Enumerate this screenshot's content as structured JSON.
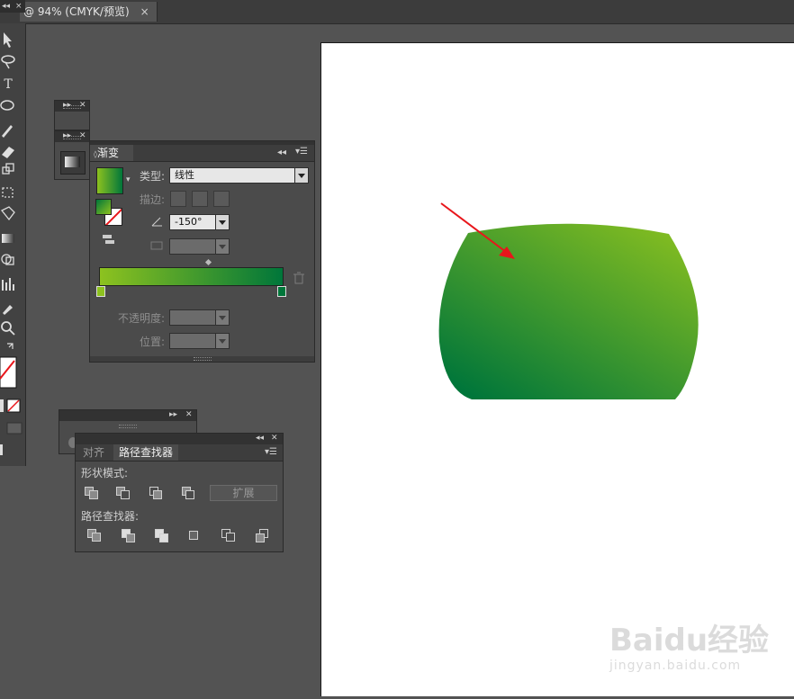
{
  "document": {
    "tab_title": "@ 94% (CMYK/预览)",
    "close_glyph": "×"
  },
  "toolbox": {
    "collapse_glyph": "◂◂",
    "close_glyph": "×",
    "tools": [
      "selection-tool",
      "lasso-tool",
      "type-tool",
      "ellipse-tool",
      "pencil-tool",
      "eraser-tool",
      "scale-tool",
      "free-transform-tool",
      "shape-builder-tool",
      "mesh-tool",
      "blend-tool",
      "graph-tool",
      "eyedropper-tool",
      "zoom-tool",
      "swap-colors-tool"
    ],
    "type_tool_glyph": "T"
  },
  "gradient_panel": {
    "title": "渐变",
    "type_label": "类型:",
    "type_value": "线性",
    "stroke_label": "描边:",
    "angle_value": "-150°",
    "opacity_label": "不透明度:",
    "position_label": "位置:",
    "gradient_colors": [
      "#8dc21f",
      "#00763a"
    ]
  },
  "pathfinder_panel": {
    "tabs": [
      "对齐",
      "路径查找器"
    ],
    "shape_modes_label": "形状模式:",
    "expand_label": "扩展",
    "pathfinders_label": "路径查找器:"
  },
  "watermark": {
    "brand": "Baidu经验",
    "url": "jingyan.baidu.com"
  },
  "colors": {
    "shape_light_green": "#8dc21f",
    "shape_dark_green": "#00763a",
    "arrow_red": "#e8161b"
  }
}
